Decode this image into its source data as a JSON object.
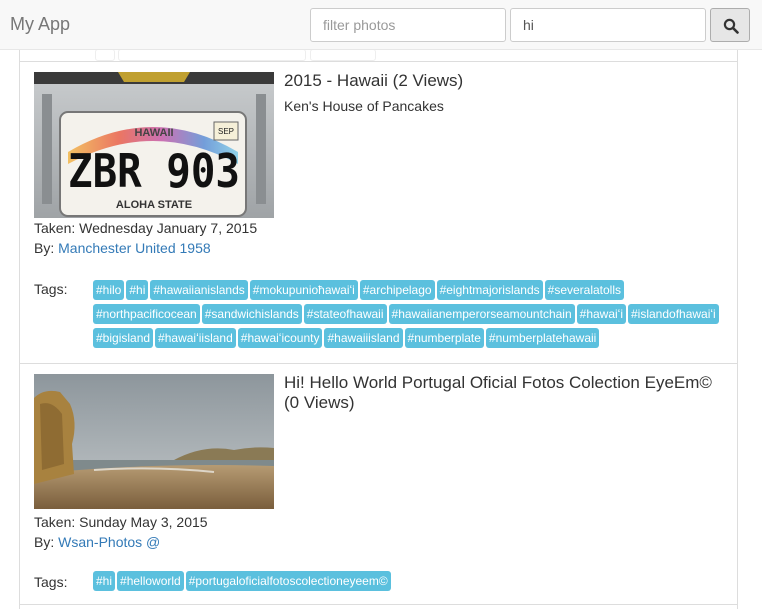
{
  "app": {
    "brand": "My App"
  },
  "search": {
    "filter_placeholder": "filter photos",
    "query_value": "hi",
    "button_icon": "search-icon"
  },
  "results": [
    {
      "title": "2015 - Hawaii (2 Views)",
      "subtitle": "Ken's House of Pancakes",
      "taken_label": "Taken:",
      "taken_date": "Wednesday January 7, 2015",
      "by_label": "By:",
      "author": "Manchester United 1958",
      "tags_label": "Tags:",
      "photo": {
        "plate_text": "ZBR 903",
        "state_top": "HAWAII",
        "state_bottom": "ALOHA STATE",
        "sticker": "SEP"
      },
      "tags": [
        "#hilo",
        "#hi",
        "#hawaiianislands",
        "#mokupunioħawaiʻi",
        "#archipelago",
        "#eightmajorislands",
        "#severalatolls",
        "#northpacificocean",
        "#sandwichislands",
        "#stateofhawaii",
        "#hawaiianemperorseamountchain",
        "#hawaiʻi",
        "#islandofhawaiʻi",
        "#bigisland",
        "#hawaiʻiisland",
        "#hawaiʻicounty",
        "#hawaiiisland",
        "#numberplate",
        "#numberplatehawaii"
      ]
    },
    {
      "title": "Hi! Hello World Portugal Oficial Fotos Colection EyeEm© (0 Views)",
      "taken_label": "Taken:",
      "taken_date": "Sunday May 3, 2015",
      "by_label": "By:",
      "author": "Wsan-Photos @",
      "tags_label": "Tags:",
      "tags": [
        "#hi",
        "#helloworld",
        "#portugaloficialfotoscolectioneyeem©"
      ]
    }
  ]
}
